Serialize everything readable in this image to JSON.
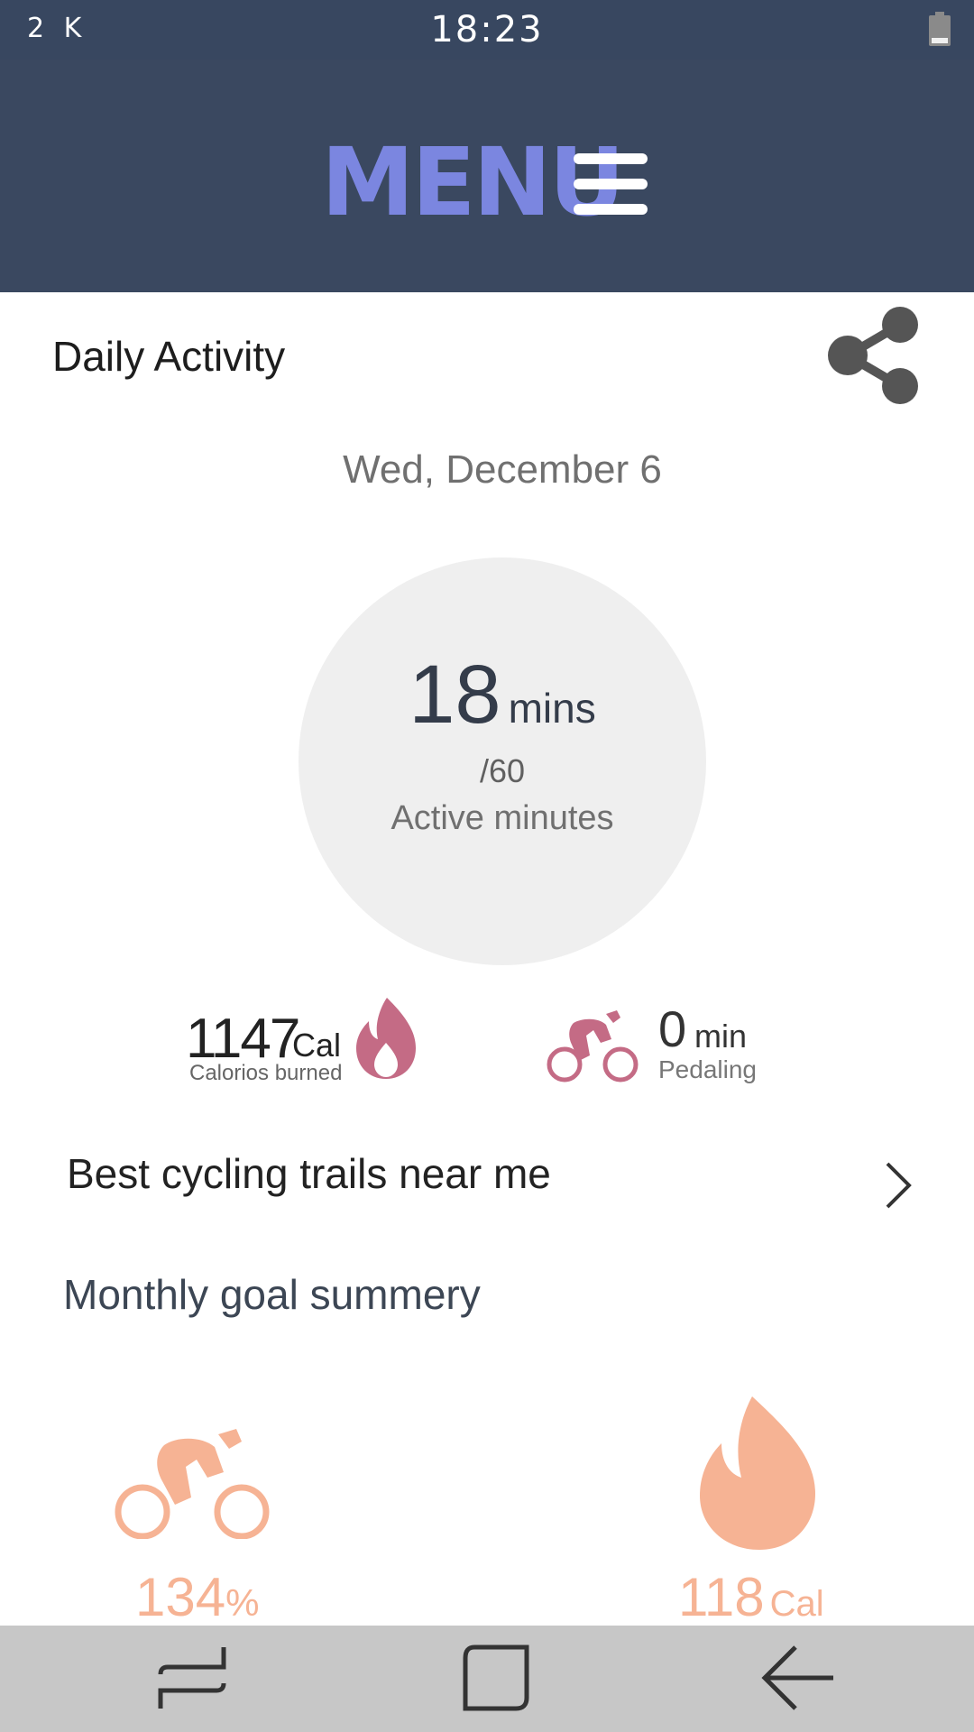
{
  "status_bar": {
    "left_text": "2 K",
    "time": "18:23",
    "battery_icon": "battery-icon"
  },
  "header": {
    "title": "MENU",
    "menu_icon": "hamburger-menu-icon",
    "title_color": "#7b86e0",
    "background": "#3a4860"
  },
  "daily_activity": {
    "title": "Daily Activity",
    "share_icon": "share-icon",
    "date": "Wed, December 6",
    "active_minutes": {
      "value": "18",
      "unit": "mins",
      "target": "/60",
      "label": "Active minutes"
    },
    "calories": {
      "value": "1147",
      "unit": "Cal",
      "label": "Calorios burned",
      "icon": "flame-icon"
    },
    "pedaling": {
      "value": "0",
      "unit": "min",
      "label": "Pedaling",
      "icon": "bicycle-icon"
    },
    "accent_color": "#c46b85"
  },
  "trails_link": {
    "label": "Best cycling trails near me",
    "icon": "chevron-right-icon"
  },
  "monthly": {
    "title": "Monthly goal summery",
    "percent": {
      "value": "134",
      "unit": "%",
      "icon": "bicycle-icon"
    },
    "calories": {
      "value": "118",
      "unit": "Cal",
      "icon": "flame-icon"
    },
    "accent_color": "#f6b394"
  },
  "nav_bar": {
    "recent_icon": "recent-apps-icon",
    "home_icon": "home-icon",
    "back_icon": "back-arrow-icon"
  }
}
